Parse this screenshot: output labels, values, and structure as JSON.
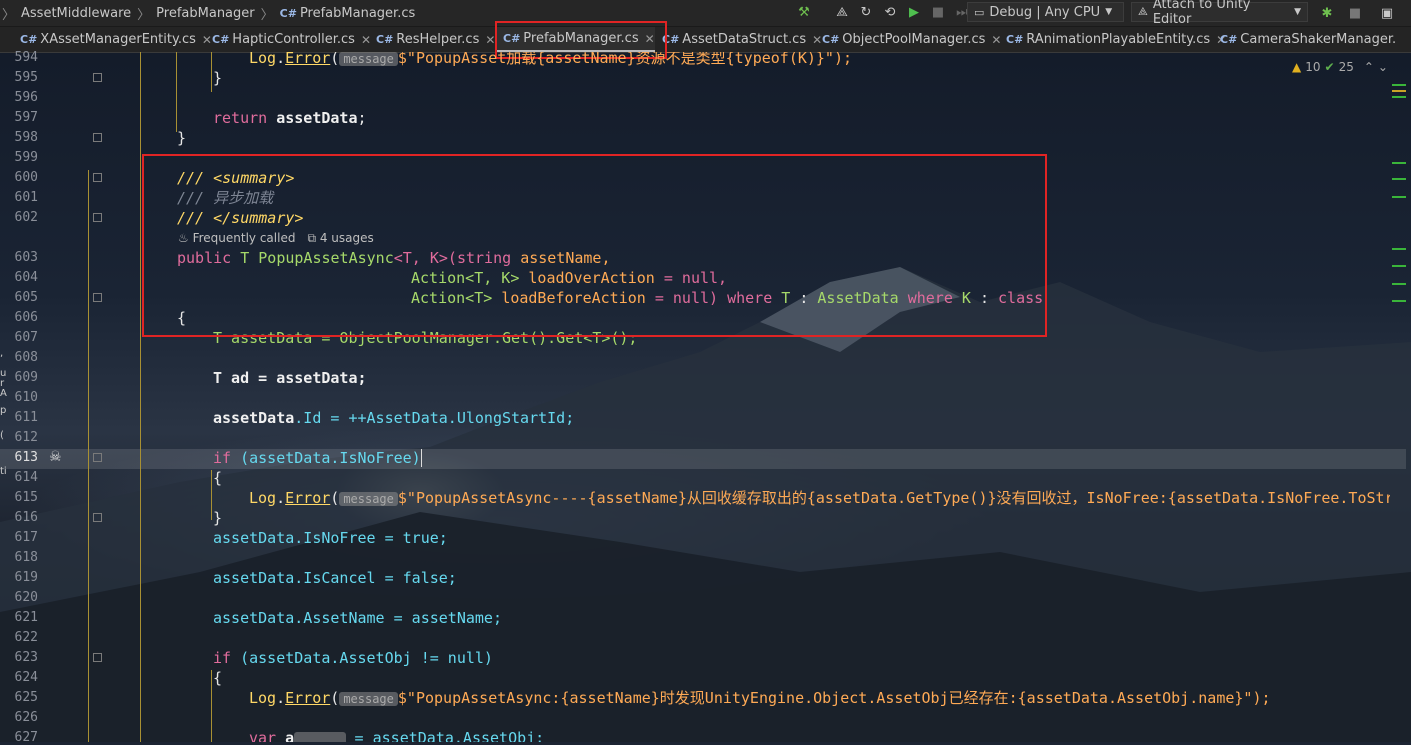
{
  "breadcrumbs": [
    "AssetMiddleware",
    "PrefabManager",
    "PrefabManager.cs"
  ],
  "toolbar": {
    "config": "Debug | Any CPU",
    "attach": "Attach to Unity Editor"
  },
  "tabs": [
    "XAssetManagerEntity.cs",
    "HapticController.cs",
    "ResHelper.cs",
    "PrefabManager.cs",
    "AssetDataStruct.cs",
    "ObjectPoolManager.cs",
    "RAnimationPlayableEntity.cs",
    "CameraShakerManager."
  ],
  "inspections": {
    "warnings": "10",
    "hints": "25"
  },
  "code_meta": {
    "frequency": "Frequently called",
    "usages": "4 usages"
  },
  "line_numbers": [
    "594",
    "595",
    "596",
    "597",
    "598",
    "599",
    "600",
    "601",
    "602",
    "603",
    "604",
    "605",
    "606",
    "607",
    "608",
    "609",
    "610",
    "611",
    "612",
    "613",
    "614",
    "615",
    "616",
    "617",
    "618",
    "619",
    "620",
    "621",
    "622",
    "623",
    "624",
    "625",
    "626",
    "627"
  ],
  "left_strip": [
    ",",
    "u",
    "r",
    "A",
    "p",
    "(",
    "ti"
  ],
  "code": {
    "l594_log": "Log",
    "l594_error": "Error",
    "l594_hint": "message",
    "l594_str": "$\"PopupAsset加载{assetName}资源不是类型{typeof(K)}\");",
    "return_kw": "return",
    "return_var": "assetData",
    "summary_open": "/// <summary>",
    "summary_text": "/// 异步加载",
    "summary_close": "/// </summary>",
    "sig_public": "public",
    "sig_T": "T",
    "sig_name": "PopupAssetAsync",
    "sig_generic": "<T, K>(",
    "sig_string": "string",
    "sig_assetName": "assetName,",
    "sig_action1": "Action<T, K>",
    "sig_loadOver": "loadOverAction",
    "sig_null1": "= null,",
    "sig_action2": "Action<T>",
    "sig_loadBefore": "loadBeforeAction",
    "sig_null2": "= null)",
    "sig_where1": "where",
    "sig_T2": "T",
    "sig_colon1": ":",
    "sig_AssetData": "AssetData",
    "sig_where2": "where",
    "sig_K": "K",
    "sig_colon2": ":",
    "sig_class": "class",
    "l607": "T assetData = ObjectPoolManager.Get().Get<T>();",
    "l609": "T ad = assetData;",
    "l611_var": "assetData",
    "l611_rest": ".Id = ++AssetData.UlongStartId;",
    "l613_if": "if",
    "l613_rest": "(assetData.IsNoFree)",
    "l615_log": "Log",
    "l615_error": "Error",
    "l615_hint": "message",
    "l615_str": "$\"PopupAssetAsync----{assetName}从回收缓存取出的{assetData.GetType()}没有回收过，IsNoFree:{assetData.IsNoFree.ToStr",
    "l617": "assetData.IsNoFree = true;",
    "l619": "assetData.IsCancel = false;",
    "l621": "assetData.AssetName = assetName;",
    "l623_if": "if",
    "l623_rest": "(assetData.AssetObj != null)",
    "l625_log": "Log",
    "l625_error": "Error",
    "l625_hint": "message",
    "l625_str": "$\"PopupAssetAsync:{assetName}时发现UnityEngine.Object.AssetObj已经存在:{assetData.AssetObj.name}\");",
    "l627_var": "var",
    "l627_a": "a",
    "l627_rest": "= assetData.AssetObj;",
    "brace_open": "{",
    "brace_close": "}"
  }
}
